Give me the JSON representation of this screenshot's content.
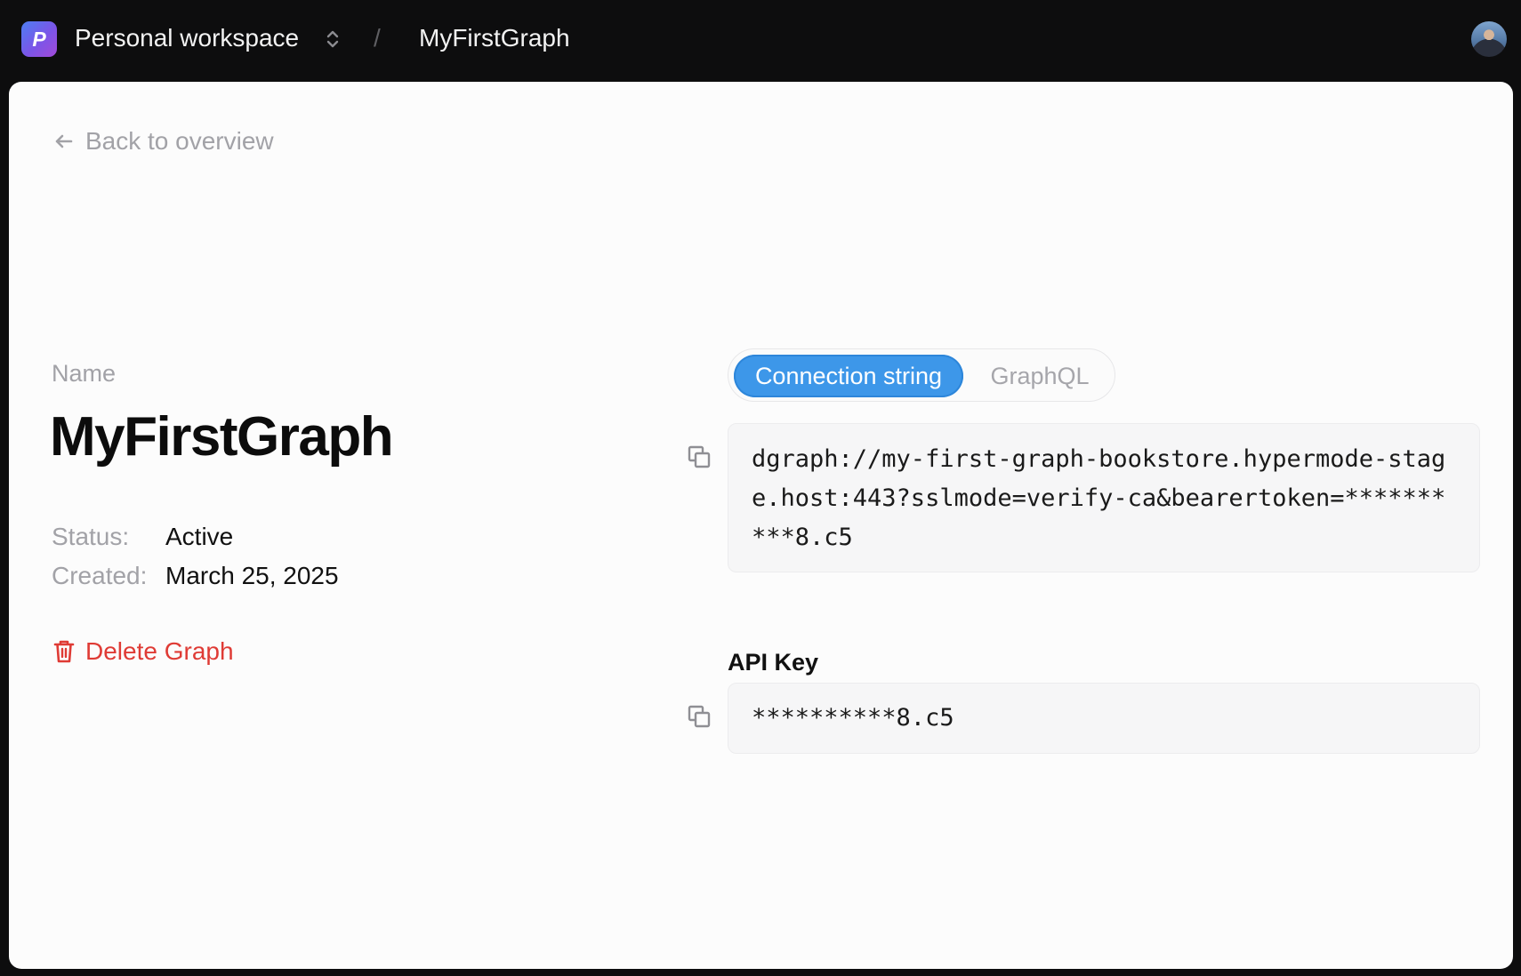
{
  "header": {
    "logo_letter": "P",
    "workspace": "Personal workspace",
    "separator": "/",
    "graph": "MyFirstGraph"
  },
  "nav": {
    "back": "Back to overview"
  },
  "graph": {
    "name_label": "Name",
    "name": "MyFirstGraph",
    "status_label": "Status:",
    "status": "Active",
    "created_label": "Created:",
    "created": "March 25, 2025",
    "delete_label": "Delete Graph"
  },
  "tabs": {
    "connection_string": "Connection string",
    "graphql": "GraphQL",
    "active": "Connection string"
  },
  "connection": {
    "value": "dgraph://my-first-graph-bookstore.hypermode-stage.host:443?sslmode=verify-ca&bearertoken=**********8.c5"
  },
  "api_key": {
    "label": "API Key",
    "value": "**********8.c5"
  },
  "colors": {
    "topbar": "#0d0d0e",
    "card": "#fcfcfc",
    "accent": "#3d97e9",
    "danger": "#df3b35",
    "muted_text": "#a2a2a7"
  },
  "icons": {
    "workspace_switch": "chevron-up-down-icon",
    "back": "arrow-left-icon",
    "delete": "trash-icon",
    "copy": "copy-icon"
  }
}
